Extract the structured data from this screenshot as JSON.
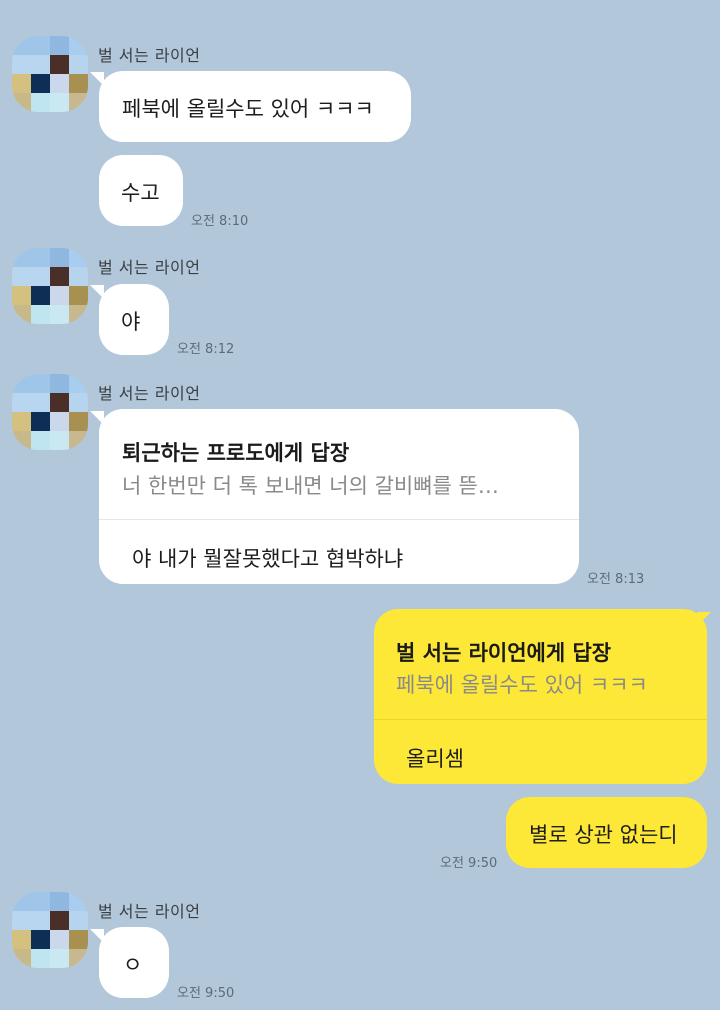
{
  "sender_name": "벌 서는 라이언",
  "messages": {
    "m1": {
      "text": "페북에 올릴수도 있어 ㅋㅋㅋ"
    },
    "m2": {
      "text": "수고",
      "time": "오전 8:10"
    },
    "m3": {
      "text": "야",
      "time": "오전 8:12"
    },
    "m4": {
      "reply_title": "퇴근하는 프로도에게 답장",
      "reply_quote": "너 한번만 더 톡 보내면 너의 갈비뼈를 뜯…",
      "text": "야 내가 뭘잘못했다고 협박하냐",
      "time": "오전 8:13"
    },
    "m5": {
      "reply_title": "벌 서는 라이언에게 답장",
      "reply_quote": "페북에 올릴수도 있어 ㅋㅋㅋ",
      "text": "올리셈"
    },
    "m6": {
      "text": "별로 상관 없는디",
      "time": "오전 9:50"
    },
    "m7": {
      "text": "ㅇ",
      "time": "오전 9:50"
    }
  },
  "colors": {
    "background": "#b2c7da",
    "bubble_in": "#ffffff",
    "bubble_out": "#fee837"
  },
  "avatar_icon": "pixelated-profile-avatar"
}
